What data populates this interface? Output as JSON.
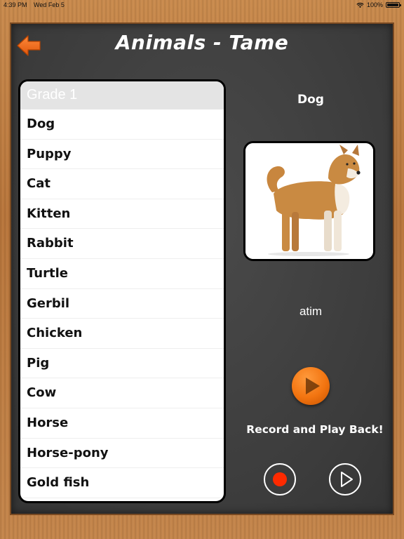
{
  "status_bar": {
    "time": "4:39 PM",
    "date": "Wed Feb 5",
    "battery": "100%"
  },
  "header": {
    "title": "Animals - Tame",
    "back_icon": "back-arrow-icon"
  },
  "list": {
    "header": "Grade 1",
    "items": [
      {
        "label": "Dog"
      },
      {
        "label": "Puppy"
      },
      {
        "label": "Cat"
      },
      {
        "label": "Kitten"
      },
      {
        "label": "Rabbit"
      },
      {
        "label": "Turtle"
      },
      {
        "label": "Gerbil"
      },
      {
        "label": "Chicken"
      },
      {
        "label": "Pig"
      },
      {
        "label": "Cow"
      },
      {
        "label": "Horse"
      },
      {
        "label": "Horse-pony"
      },
      {
        "label": "Gold fish"
      }
    ]
  },
  "detail": {
    "word": "Dog",
    "translation": "atim",
    "image": "dog-photo",
    "record_caption": "Record and Play Back!"
  },
  "colors": {
    "accent": "#f27410",
    "record": "#ff2a00",
    "board": "#3f3f3f",
    "frame": "#b8743a"
  }
}
